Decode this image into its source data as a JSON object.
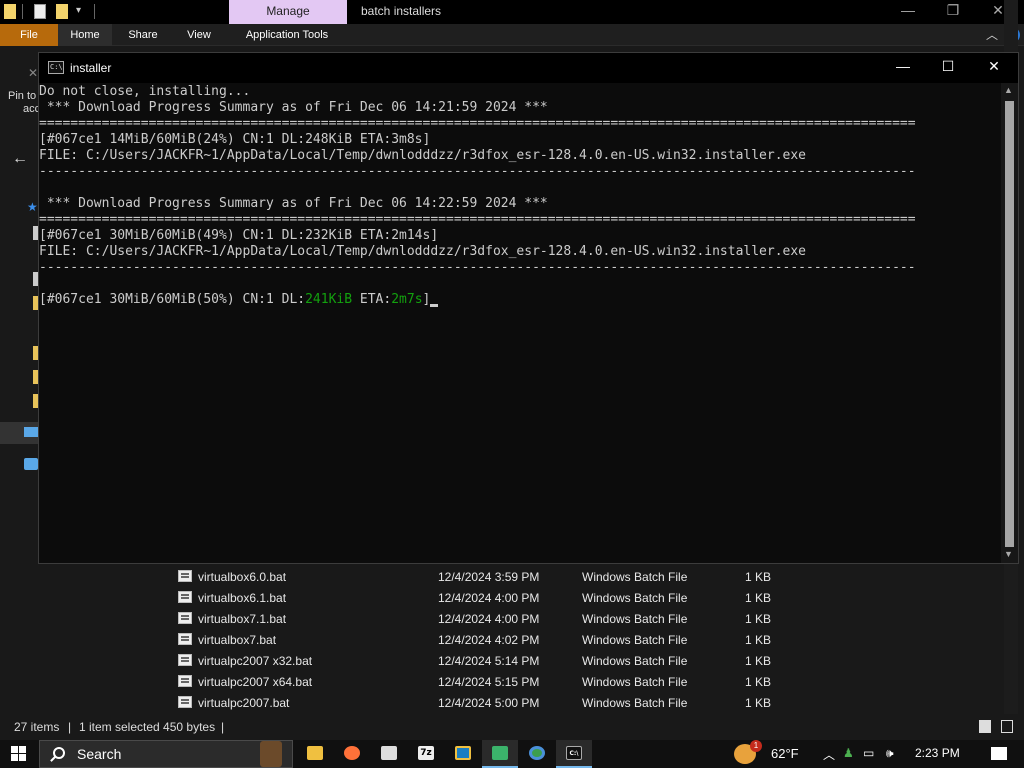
{
  "explorer": {
    "window_title": "batch installers",
    "context_tab": "Manage",
    "ribbon_tabs": [
      "File",
      "Home",
      "Share",
      "View",
      "Application Tools"
    ],
    "pin_text_1": "Pin to",
    "pin_text_2": "acc",
    "files": [
      {
        "name": "virtualbox6.0.bat",
        "date": "12/4/2024 3:59 PM",
        "type": "Windows Batch File",
        "size": "1 KB"
      },
      {
        "name": "virtualbox6.1.bat",
        "date": "12/4/2024 4:00 PM",
        "type": "Windows Batch File",
        "size": "1 KB"
      },
      {
        "name": "virtualbox7.1.bat",
        "date": "12/4/2024 4:00 PM",
        "type": "Windows Batch File",
        "size": "1 KB"
      },
      {
        "name": "virtualbox7.bat",
        "date": "12/4/2024 4:02 PM",
        "type": "Windows Batch File",
        "size": "1 KB"
      },
      {
        "name": "virtualpc2007 x32.bat",
        "date": "12/4/2024 5:14 PM",
        "type": "Windows Batch File",
        "size": "1 KB"
      },
      {
        "name": "virtualpc2007 x64.bat",
        "date": "12/4/2024 5:15 PM",
        "type": "Windows Batch File",
        "size": "1 KB"
      },
      {
        "name": "virtualpc2007.bat",
        "date": "12/4/2024 5:00 PM",
        "type": "Windows Batch File",
        "size": "1 KB"
      }
    ],
    "status": {
      "item_count": "27 items",
      "selection": "1 item selected  450 bytes"
    }
  },
  "console": {
    "title": "installer",
    "lines": [
      "Do not close, installing...",
      " *** Download Progress Summary as of Fri Dec 06 14:21:59 2024 ***",
      "================================================================================================================",
      "[#067ce1 14MiB/60MiB(24%) CN:1 DL:248KiB ETA:3m8s]",
      "FILE: C:/Users/JACKFR~1/AppData/Local/Temp/dwnlodddzz/r3dfox_esr-128.4.0.en-US.win32.installer.exe",
      "----------------------------------------------------------------------------------------------------------------",
      "",
      " *** Download Progress Summary as of Fri Dec 06 14:22:59 2024 ***",
      "================================================================================================================",
      "[#067ce1 30MiB/60MiB(49%) CN:1 DL:232KiB ETA:2m14s]",
      "FILE: C:/Users/JACKFR~1/AppData/Local/Temp/dwnlodddzz/r3dfox_esr-128.4.0.en-US.win32.installer.exe",
      "----------------------------------------------------------------------------------------------------------------",
      ""
    ],
    "live_line": {
      "prefix": "[#067ce1 30MiB/60MiB(50%) CN:1 DL:",
      "speed": "241KiB",
      "mid": " ETA:",
      "eta": "2m7s",
      "suffix": "]"
    },
    "colors": {
      "text": "#cccccc",
      "highlight": "#13a10e",
      "background": "#0c0c0c"
    }
  },
  "taskbar": {
    "search_placeholder": "Search",
    "weather_temp": "62°F",
    "weather_badge": "1",
    "clock": "2:23 PM",
    "apps": [
      "file-explorer",
      "firefox",
      "app-3",
      "7zip",
      "virtualbox",
      "app-6",
      "chrome",
      "command-prompt"
    ]
  }
}
